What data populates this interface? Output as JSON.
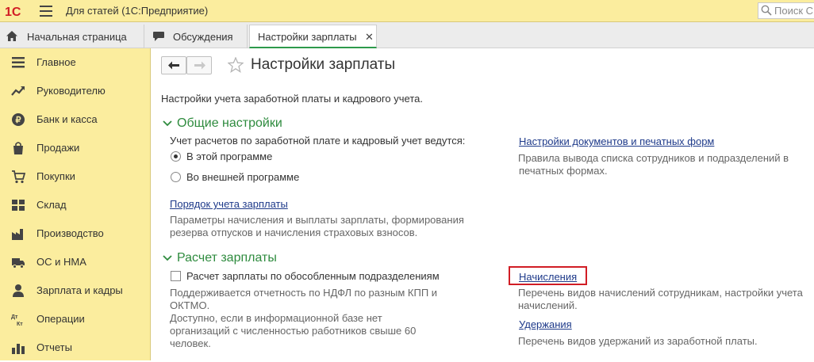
{
  "colors": {
    "top_bar": "#fbed9e",
    "accent_green": "#2e8b3e",
    "link": "#1e3a8a",
    "highlight": "#d11d25"
  },
  "topbar": {
    "logo": "1С",
    "menu_icon": "hamburger-icon",
    "title": "Для статей  (1С:Предприятие)",
    "search_placeholder": "Поиск С"
  },
  "tabs": [
    {
      "label": "Начальная страница",
      "icon": "home-icon"
    },
    {
      "label": "Обсуждения",
      "icon": "chat-icon"
    },
    {
      "label": "Настройки зарплаты",
      "active": true,
      "close_icon": "close-icon"
    }
  ],
  "sidebar": {
    "items": [
      {
        "label": "Главное",
        "icon": "menu-lines-icon"
      },
      {
        "label": "Руководителю",
        "icon": "trend-icon"
      },
      {
        "label": "Банк и касса",
        "icon": "coin-icon"
      },
      {
        "label": "Продажи",
        "icon": "bag-icon"
      },
      {
        "label": "Покупки",
        "icon": "cart-icon"
      },
      {
        "label": "Склад",
        "icon": "grid-icon"
      },
      {
        "label": "Производство",
        "icon": "factory-icon"
      },
      {
        "label": "ОС и НМА",
        "icon": "truck-icon"
      },
      {
        "label": "Зарплата и кадры",
        "icon": "person-icon"
      },
      {
        "label": "Операции",
        "icon": "dt-kt-icon"
      },
      {
        "label": "Отчеты",
        "icon": "bar-chart-icon"
      }
    ]
  },
  "main": {
    "title": "Настройки зарплаты",
    "description": "Настройки учета заработной платы и кадрового учета.",
    "general": {
      "heading": "Общие настройки",
      "question": "Учет расчетов по заработной плате и кадровый учет ведутся:",
      "options": [
        "В этой программе",
        "Во внешней программе"
      ],
      "selected_index": 0,
      "payroll_link": "Порядок учета зарплаты",
      "payroll_hint_1": "Параметры начисления и выплаты зарплаты, формирования",
      "payroll_hint_2": "резерва отпусков и начисления страховых взносов.",
      "docs_link": "Настройки документов и печатных форм",
      "docs_hint_1": "Правила вывода списка сотрудников и подразделений в",
      "docs_hint_2": "печатных формах."
    },
    "calc": {
      "heading": "Расчет зарплаты",
      "checkbox_label": "Расчет зарплаты по обособленным подразделениям",
      "checkbox_checked": false,
      "hint_lines": [
        "Поддерживается отчетность по НДФЛ по разным КПП и",
        "ОКТМО.",
        "Доступно, если в информационной базе нет",
        "организаций с численностью работников свыше 60",
        "человек."
      ],
      "accruals_link": "Начисления",
      "accruals_hint_1": "Перечень видов начислений сотрудникам, настройки учета",
      "accruals_hint_2": "начислений.",
      "deductions_link": "Удержания",
      "deductions_hint": "Перечень видов удержаний из заработной платы."
    }
  }
}
